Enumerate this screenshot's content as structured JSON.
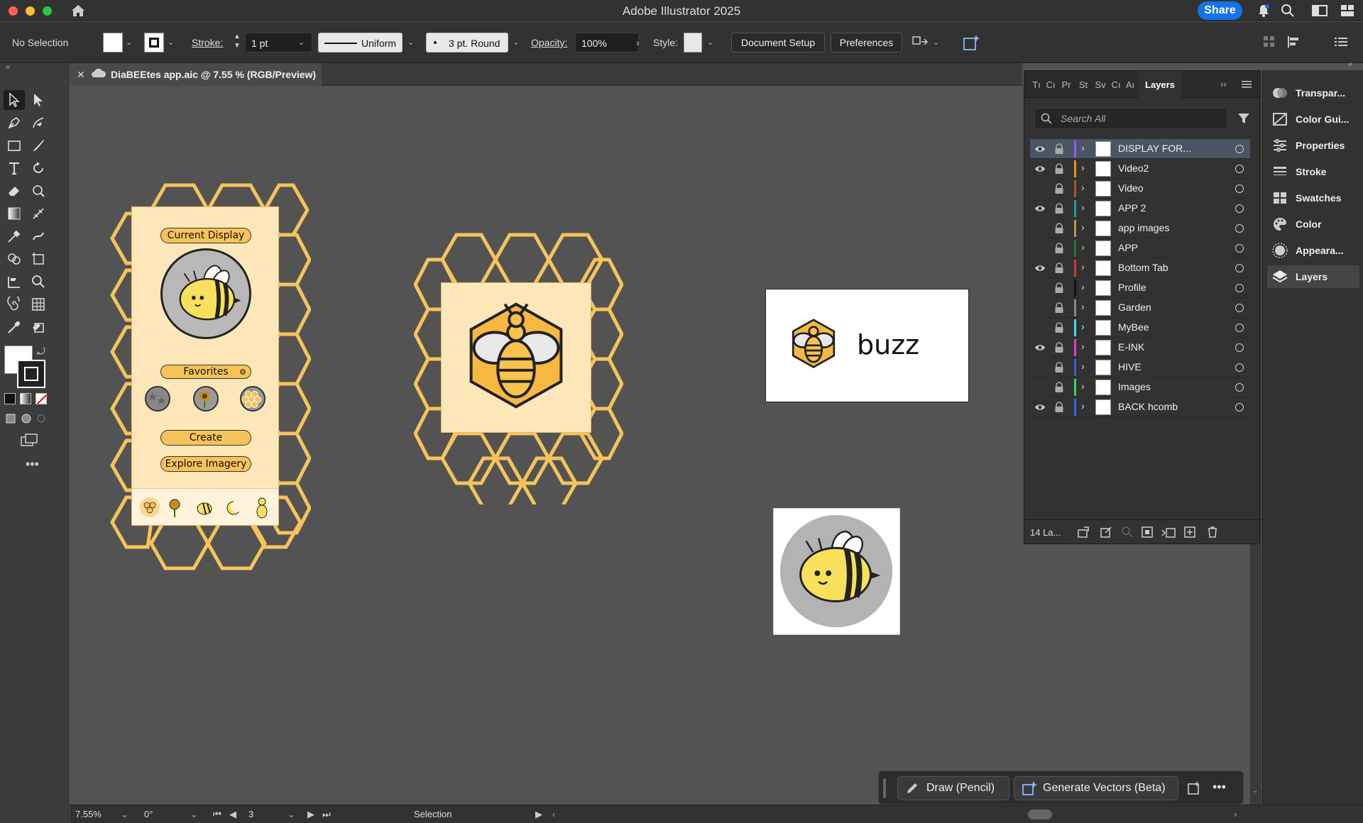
{
  "window": {
    "title": "Adobe Illustrator 2025",
    "share_label": "Share"
  },
  "controlbar": {
    "selection": "No Selection",
    "stroke_label": "Stroke:",
    "stroke_weight": "1 pt",
    "profile": "Uniform",
    "brush": "3 pt. Round",
    "opacity_label": "Opacity:",
    "opacity": "100%",
    "style_label": "Style:",
    "document_setup": "Document Setup",
    "preferences": "Preferences"
  },
  "document": {
    "tab_title": "DiaBEEtes app.aic @ 7.55 % (RGB/Preview)"
  },
  "artboards": {
    "app": {
      "current_display": "Current Display",
      "favorites": "Favorites",
      "create": "Create",
      "explore": "Explore Imagery"
    },
    "logo_text": "buzz"
  },
  "layers_panel": {
    "tabs": [
      "Tı",
      "Cı",
      "Pr",
      "St",
      "Sv",
      "Cı",
      "Aı"
    ],
    "active_tab": "Layers",
    "search_placeholder": "Search All",
    "count_label": "14 La...",
    "layers": [
      {
        "name": "DISPLAY FOR...",
        "visible": true,
        "color": "#9b59ff",
        "selected": true
      },
      {
        "name": "Video2",
        "visible": true,
        "color": "#f08c1a"
      },
      {
        "name": "Video",
        "visible": false,
        "color": "#b5531b"
      },
      {
        "name": "APP 2",
        "visible": true,
        "color": "#19a19a"
      },
      {
        "name": "app images",
        "visible": false,
        "color": "#c4904a"
      },
      {
        "name": "APP",
        "visible": false,
        "color": "#1e7a2a"
      },
      {
        "name": "Bottom Tab",
        "visible": true,
        "color": "#d8342c"
      },
      {
        "name": "Profile",
        "visible": false,
        "color": "#111111"
      },
      {
        "name": "Garden",
        "visible": false,
        "color": "#8a8a8a"
      },
      {
        "name": "MyBee",
        "visible": false,
        "color": "#4ad8e8"
      },
      {
        "name": "E-INK",
        "visible": true,
        "color": "#e33ad8"
      },
      {
        "name": "HIVE",
        "visible": false,
        "color": "#3d5bd9"
      },
      {
        "name": "Images",
        "visible": false,
        "color": "#3ad84a"
      },
      {
        "name": "BACK hcomb",
        "visible": true,
        "color": "#3a63e8"
      }
    ]
  },
  "dock": {
    "items": [
      "Transpar...",
      "Color Gui...",
      "Properties",
      "Stroke",
      "Swatches",
      "Color",
      "Appeara...",
      "Layers"
    ]
  },
  "context_bar": {
    "draw": "Draw (Pencil)",
    "generate": "Generate Vectors (Beta)"
  },
  "status": {
    "zoom": "7.55%",
    "rotation": "0°",
    "artboard": "3",
    "tool": "Selection"
  }
}
